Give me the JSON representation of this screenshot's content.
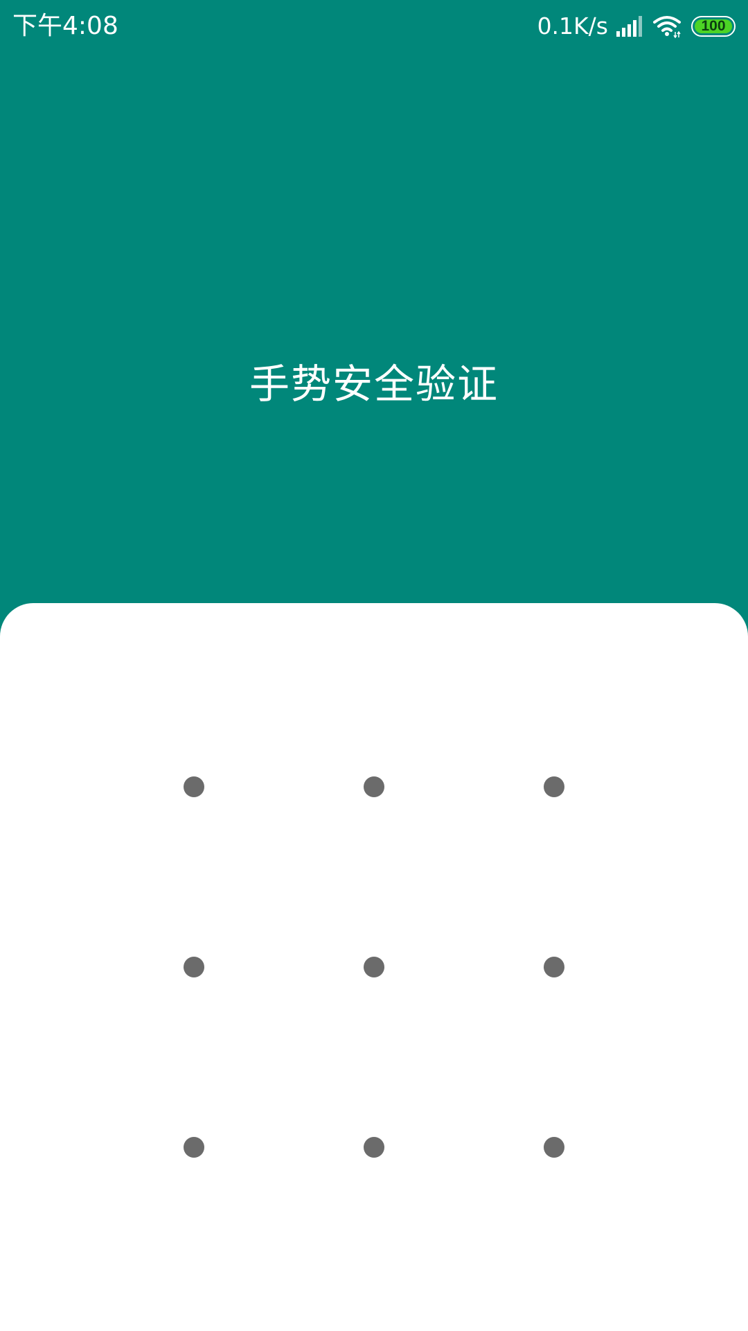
{
  "status_bar": {
    "time": "下午4:08",
    "net_speed": "0.1K/s",
    "battery_level": "100",
    "icons": [
      "signal-icon",
      "wifi-icon",
      "battery-icon"
    ]
  },
  "header": {
    "title": "手势安全验证"
  },
  "pattern_lock": {
    "rows": 3,
    "columns": 3,
    "dots": [
      "1",
      "2",
      "3",
      "4",
      "5",
      "6",
      "7",
      "8",
      "9"
    ]
  },
  "colors": {
    "header_background": "#01877A",
    "panel_background": "#FFFFFF",
    "dot_color": "#6B6B6B",
    "battery_fill": "#4CD425"
  }
}
